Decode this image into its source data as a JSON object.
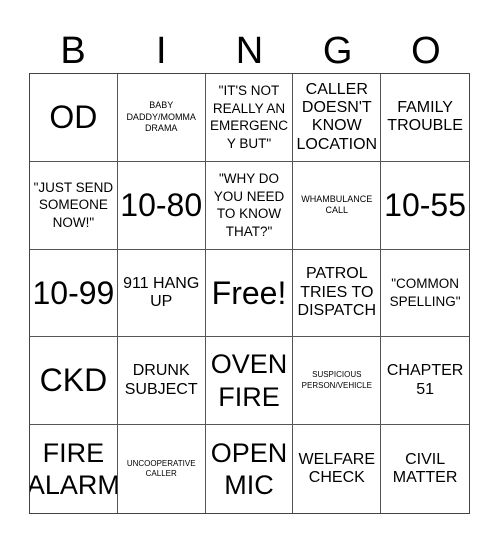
{
  "header": [
    "B",
    "I",
    "N",
    "G",
    "O"
  ],
  "cells": [
    {
      "text": "OD",
      "size": "s-xl"
    },
    {
      "text": "BABY DADDY/MOMMA DRAMA",
      "size": "s-xs"
    },
    {
      "text": "\"IT'S NOT REALLY AN EMERGENCY BUT\"",
      "size": "s-sm"
    },
    {
      "text": "CALLER DOESN'T KNOW LOCATION",
      "size": "s-md"
    },
    {
      "text": "FAMILY TROUBLE",
      "size": "s-md"
    },
    {
      "text": "\"JUST SEND SOMEONE NOW!\"",
      "size": "s-sm"
    },
    {
      "text": "10-80",
      "size": "s-xl"
    },
    {
      "text": "\"WHY DO YOU NEED TO KNOW THAT?\"",
      "size": "s-sm"
    },
    {
      "text": "WHAMBULANCE CALL",
      "size": "s-xs"
    },
    {
      "text": "10-55",
      "size": "s-xl"
    },
    {
      "text": "10-99",
      "size": "s-xl"
    },
    {
      "text": "911 HANG UP",
      "size": "s-md"
    },
    {
      "text": "Free!",
      "size": "s-xl"
    },
    {
      "text": "PATROL TRIES TO DISPATCH",
      "size": "s-md"
    },
    {
      "text": "\"COMMON SPELLING\"",
      "size": "s-sm"
    },
    {
      "text": "CKD",
      "size": "s-xl"
    },
    {
      "text": "DRUNK SUBJECT",
      "size": "s-md"
    },
    {
      "text": "OVEN FIRE",
      "size": "s-lg"
    },
    {
      "text": "SUSPICIOUS PERSON/VEHICLE",
      "size": "s-xxs"
    },
    {
      "text": "CHAPTER 51",
      "size": "s-md"
    },
    {
      "text": "FIRE ALARM",
      "size": "s-lg"
    },
    {
      "text": "UNCOOPERATIVE CALLER",
      "size": "s-xxs"
    },
    {
      "text": "OPEN MIC",
      "size": "s-lg"
    },
    {
      "text": "WELFARE CHECK",
      "size": "s-md"
    },
    {
      "text": "CIVIL MATTER",
      "size": "s-md"
    }
  ]
}
